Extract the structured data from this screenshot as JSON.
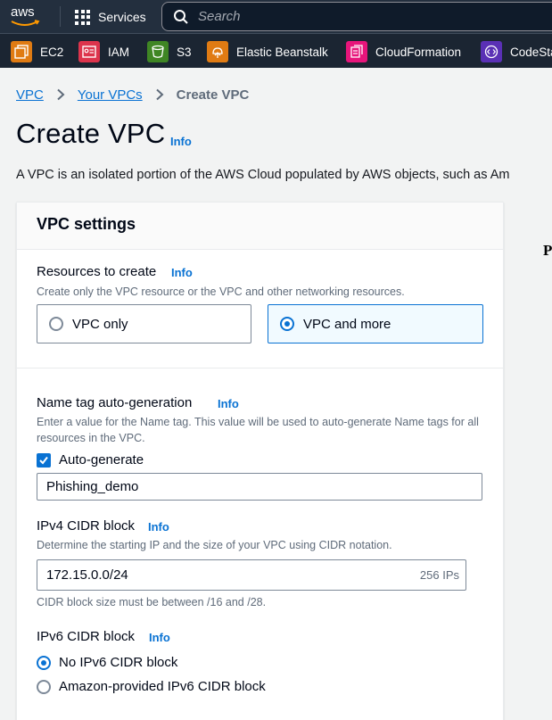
{
  "topbar": {
    "logo": "aws",
    "services_label": "Services",
    "search_placeholder": "Search"
  },
  "favorites": [
    {
      "label": "EC2",
      "icon": "ec2-icon",
      "color": "#e07b13"
    },
    {
      "label": "IAM",
      "icon": "iam-icon",
      "color": "#dd344c"
    },
    {
      "label": "S3",
      "icon": "s3-icon",
      "color": "#3f8624"
    },
    {
      "label": "Elastic Beanstalk",
      "icon": "elastic-beanstalk-icon",
      "color": "#e07b13"
    },
    {
      "label": "CloudFormation",
      "icon": "cloudformation-icon",
      "color": "#e7157b"
    },
    {
      "label": "CodeSta",
      "icon": "codestar-icon",
      "color": "#5a30b5"
    }
  ],
  "breadcrumb": {
    "items": [
      "VPC",
      "Your VPCs"
    ],
    "current": "Create VPC"
  },
  "page": {
    "title": "Create VPC",
    "info": "Info",
    "description": "A VPC is an isolated portion of the AWS Cloud populated by AWS objects, such as Am"
  },
  "panel": {
    "title": "VPC settings",
    "resources": {
      "label": "Resources to create",
      "info": "Info",
      "hint": "Create only the VPC resource or the VPC and other networking resources.",
      "options": [
        "VPC only",
        "VPC and more"
      ],
      "selected": "VPC and more"
    },
    "name_tag": {
      "label": "Name tag auto-generation",
      "info": "Info",
      "hint": "Enter a value for the Name tag. This value will be used to auto-generate Name tags for all resources in the VPC.",
      "checkbox_label": "Auto-generate",
      "checked": true,
      "value": "Phishing_demo"
    },
    "ipv4": {
      "label": "IPv4 CIDR block",
      "info": "Info",
      "hint": "Determine the starting IP and the size of your VPC using CIDR notation.",
      "value": "172.15.0.0/24",
      "suffix": "256 IPs",
      "constraint": "CIDR block size must be between /16 and /28."
    },
    "ipv6": {
      "label": "IPv6 CIDR block",
      "info": "Info",
      "options": [
        "No IPv6 CIDR block",
        "Amazon-provided IPv6 CIDR block"
      ],
      "selected": "No IPv6 CIDR block"
    }
  },
  "right_panel_letter": "P"
}
